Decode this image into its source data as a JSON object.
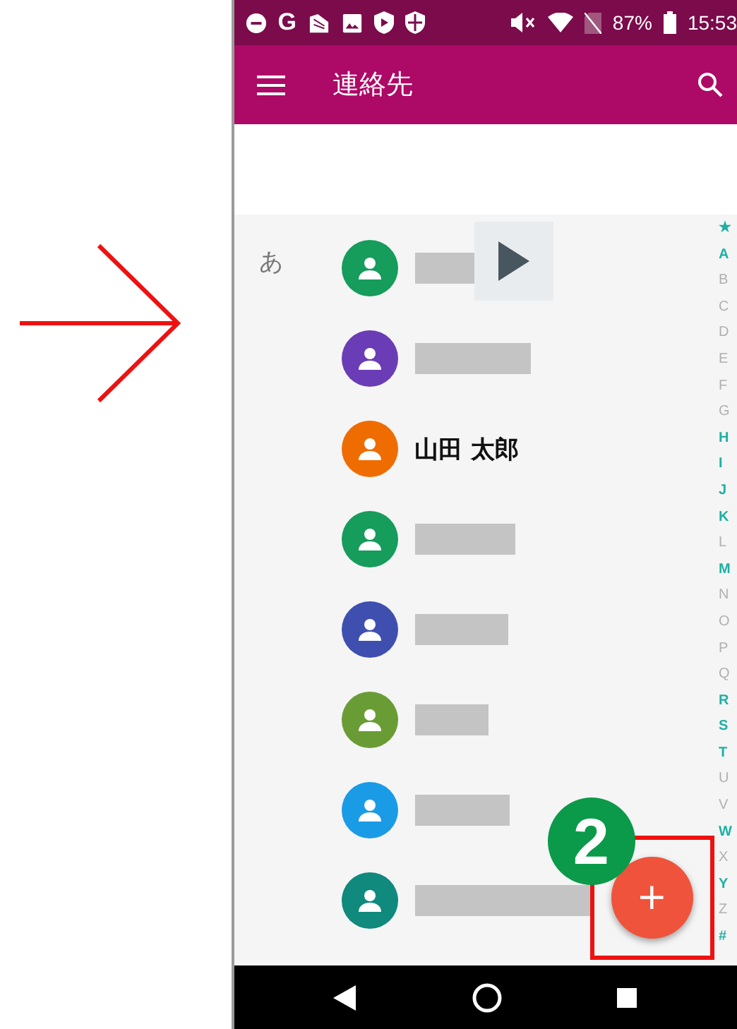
{
  "status_bar": {
    "notification_letter": "G",
    "battery": "87%",
    "time": "15:53"
  },
  "app_bar": {
    "title": "連絡先"
  },
  "section": {
    "letter": "あ"
  },
  "contacts": [
    {
      "kind": "redacted",
      "color": "#169c5b"
    },
    {
      "kind": "redacted",
      "color": "#6a3cb5"
    },
    {
      "kind": "named",
      "color": "#ef6c00",
      "name": "山田 太郎"
    },
    {
      "kind": "redacted",
      "color": "#169c5b"
    },
    {
      "kind": "redacted",
      "color": "#3f4fb0"
    },
    {
      "kind": "redacted",
      "color": "#6a9c35"
    },
    {
      "kind": "redacted",
      "color": "#1a9be6"
    },
    {
      "kind": "redacted",
      "color": "#0f8a7c"
    }
  ],
  "index": [
    {
      "label": "★",
      "active": true
    },
    {
      "label": "A",
      "active": true
    },
    {
      "label": "B",
      "active": false
    },
    {
      "label": "C",
      "active": false
    },
    {
      "label": "D",
      "active": false
    },
    {
      "label": "E",
      "active": false
    },
    {
      "label": "F",
      "active": false
    },
    {
      "label": "G",
      "active": false
    },
    {
      "label": "H",
      "active": true
    },
    {
      "label": "I",
      "active": true
    },
    {
      "label": "J",
      "active": true
    },
    {
      "label": "K",
      "active": true
    },
    {
      "label": "L",
      "active": false
    },
    {
      "label": "M",
      "active": true
    },
    {
      "label": "N",
      "active": false
    },
    {
      "label": "O",
      "active": false
    },
    {
      "label": "P",
      "active": false
    },
    {
      "label": "Q",
      "active": false
    },
    {
      "label": "R",
      "active": true
    },
    {
      "label": "S",
      "active": true
    },
    {
      "label": "T",
      "active": true
    },
    {
      "label": "U",
      "active": false
    },
    {
      "label": "V",
      "active": false
    },
    {
      "label": "W",
      "active": true
    },
    {
      "label": "X",
      "active": false
    },
    {
      "label": "Y",
      "active": true
    },
    {
      "label": "Z",
      "active": false
    },
    {
      "label": "#",
      "active": true
    }
  ],
  "fab": {
    "label": "+"
  },
  "callout": {
    "number": "2"
  }
}
